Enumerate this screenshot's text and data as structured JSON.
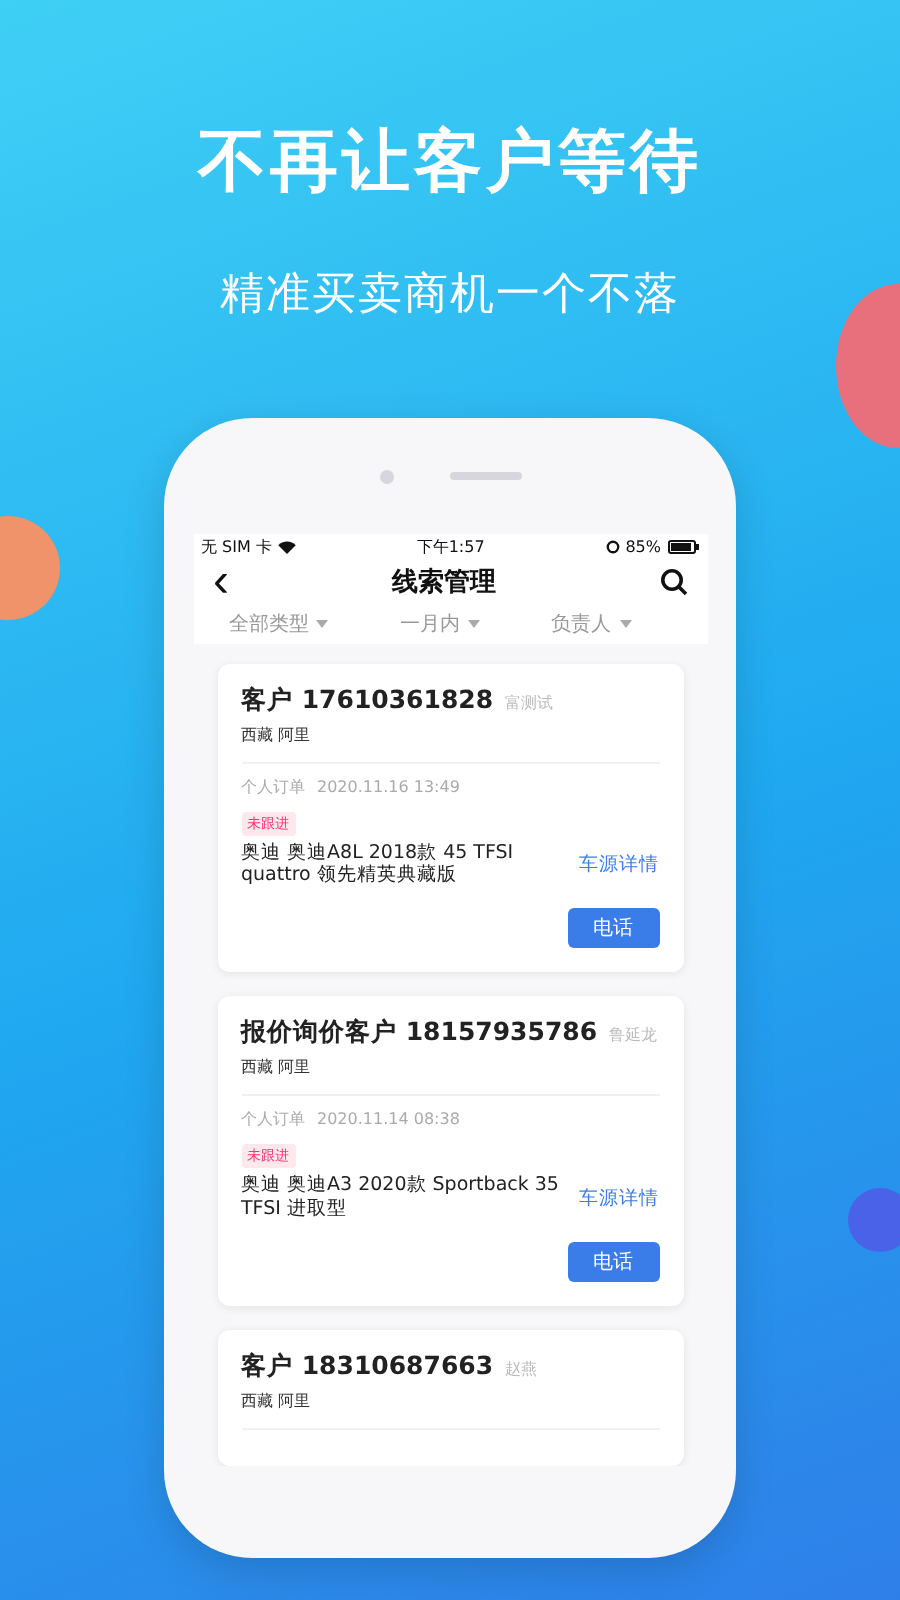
{
  "headline": "不再让客户等待",
  "subheadline": "精准买卖商机一个不落",
  "status_bar": {
    "carrier": "无 SIM 卡",
    "time": "下午1:57",
    "battery": "85%"
  },
  "nav": {
    "back": "‹",
    "title": "线索管理"
  },
  "filters": [
    {
      "label": "全部类型"
    },
    {
      "label": "一月内"
    },
    {
      "label": "负责人"
    }
  ],
  "leads": [
    {
      "type": "客户",
      "phone": "17610361828",
      "owner": "富测试",
      "region": "西藏 阿里",
      "order_type": "个人订单",
      "date": "2020.11.16 13:49",
      "tag": "未跟进",
      "car": "奥迪 奥迪A8L 2018款 45 TFSI quattro 领先精英典藏版",
      "link": "车源详情",
      "button": "电话"
    },
    {
      "type": "报价询价客户",
      "phone": "18157935786",
      "owner": "鲁延龙",
      "region": "西藏 阿里",
      "order_type": "个人订单",
      "date": "2020.11.14 08:38",
      "tag": "未跟进",
      "car": "奥迪 奥迪A3 2020款 Sportback 35 TFSI 进取型",
      "link": "车源详情",
      "button": "电话"
    },
    {
      "type": "客户",
      "phone": "18310687663",
      "owner": "赵燕",
      "region": "西藏 阿里"
    }
  ]
}
